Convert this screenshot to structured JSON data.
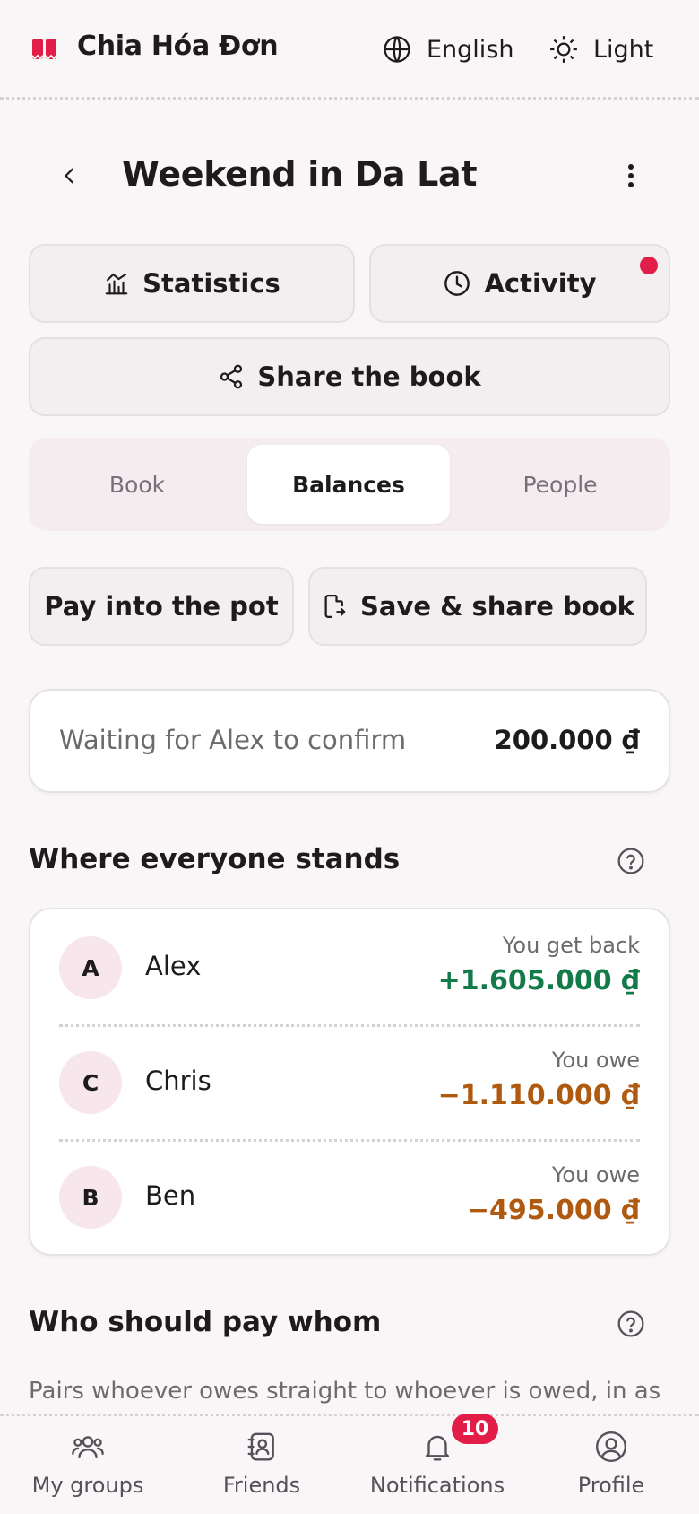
{
  "app": {
    "brand": "Chia Hóa Đơn",
    "language": "English",
    "theme": "Light"
  },
  "page": {
    "title": "Weekend in Da Lat"
  },
  "actions": {
    "statistics": "Statistics",
    "activity": "Activity",
    "share_book": "Share the book"
  },
  "tabs": [
    {
      "label": "Book"
    },
    {
      "label": "Balances",
      "active": true
    },
    {
      "label": "People"
    }
  ],
  "buttons": {
    "pay_pot": "Pay into the pot",
    "save_share": "Save & share book"
  },
  "pending": {
    "text": "Waiting for Alex to confirm",
    "amount": "200.000 ₫"
  },
  "standings": {
    "title": "Where everyone stands",
    "people": [
      {
        "initial": "A",
        "name": "Alex",
        "label": "You get back",
        "amount": "+1.605.000 ₫"
      },
      {
        "initial": "C",
        "name": "Chris",
        "label": "You owe",
        "amount": "−1.110.000 ₫"
      },
      {
        "initial": "B",
        "name": "Ben",
        "label": "You owe",
        "amount": "−495.000 ₫"
      }
    ]
  },
  "settle": {
    "title": "Who should pay whom",
    "description": "Pairs whoever owes straight to whoever is owed, in as few"
  },
  "nav": {
    "items": [
      {
        "label": "My groups",
        "icon": "users-icon"
      },
      {
        "label": "Friends",
        "icon": "contacts-icon"
      },
      {
        "label": "Notifications",
        "icon": "bell-icon"
      },
      {
        "label": "Profile",
        "icon": "profile-icon"
      }
    ],
    "notifications_badge": "10"
  },
  "colors": {
    "accent": "#e11d48",
    "positive": "#137a4a",
    "negative": "#b05a10",
    "background": "#f9f6f7"
  }
}
